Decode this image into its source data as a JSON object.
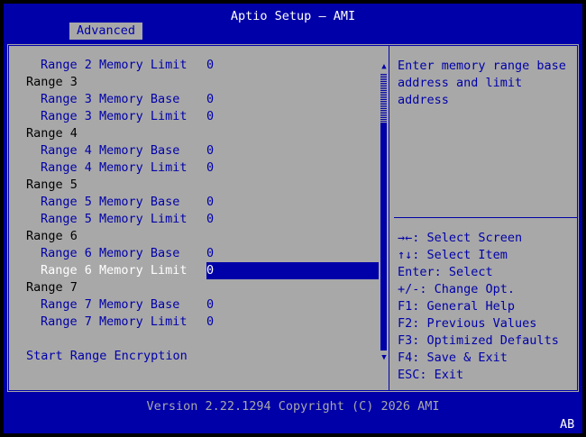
{
  "header": {
    "title": "Aptio Setup – AMI",
    "tabs": [
      {
        "label": "Advanced",
        "active": true
      }
    ]
  },
  "settings": [
    {
      "type": "sub",
      "label": "Range 2 Memory Limit",
      "value": "0"
    },
    {
      "type": "head",
      "label": "Range 3"
    },
    {
      "type": "sub",
      "label": "Range 3 Memory Base",
      "value": "0"
    },
    {
      "type": "sub",
      "label": "Range 3 Memory Limit",
      "value": "0"
    },
    {
      "type": "head",
      "label": "Range 4"
    },
    {
      "type": "sub",
      "label": "Range 4 Memory Base",
      "value": "0"
    },
    {
      "type": "sub",
      "label": "Range 4 Memory Limit",
      "value": "0"
    },
    {
      "type": "head",
      "label": "Range 5"
    },
    {
      "type": "sub",
      "label": "Range 5 Memory Base",
      "value": "0"
    },
    {
      "type": "sub",
      "label": "Range 5 Memory Limit",
      "value": "0"
    },
    {
      "type": "head",
      "label": "Range 6"
    },
    {
      "type": "sub",
      "label": "Range 6 Memory Base",
      "value": "0"
    },
    {
      "type": "sub",
      "label": "Range 6 Memory Limit",
      "value": "0",
      "selected": true
    },
    {
      "type": "head",
      "label": "Range 7"
    },
    {
      "type": "sub",
      "label": "Range 7 Memory Base",
      "value": "0"
    },
    {
      "type": "sub",
      "label": "Range 7 Memory Limit",
      "value": "0"
    },
    {
      "type": "blank",
      "label": ""
    },
    {
      "type": "action",
      "label": "Start Range Encryption"
    }
  ],
  "scrollbar": {
    "up_icon": "▲",
    "down_icon": "▼"
  },
  "help": {
    "lines": [
      "Enter memory range base",
      "address and limit",
      "address"
    ]
  },
  "keys": [
    {
      "key": "→←",
      "desc": ": Select Screen"
    },
    {
      "key": "↑↓",
      "desc": ": Select Item"
    },
    {
      "key": "Enter",
      "desc": ": Select"
    },
    {
      "key": "+/-",
      "desc": ": Change Opt."
    },
    {
      "key": "F1",
      "desc": ": General Help"
    },
    {
      "key": "F2",
      "desc": ": Previous Values"
    },
    {
      "key": "F3",
      "desc": ": Optimized Defaults"
    },
    {
      "key": "F4",
      "desc": ": Save & Exit"
    },
    {
      "key": "ESC",
      "desc": ": Exit"
    }
  ],
  "footer": {
    "version": "Version 2.22.1294 Copyright (C) 2026 AMI",
    "badge": "AB"
  },
  "colors": {
    "background": "#0000a8",
    "panel": "#a8a8a8",
    "highlight": "#ffffff",
    "text": "#000000"
  }
}
